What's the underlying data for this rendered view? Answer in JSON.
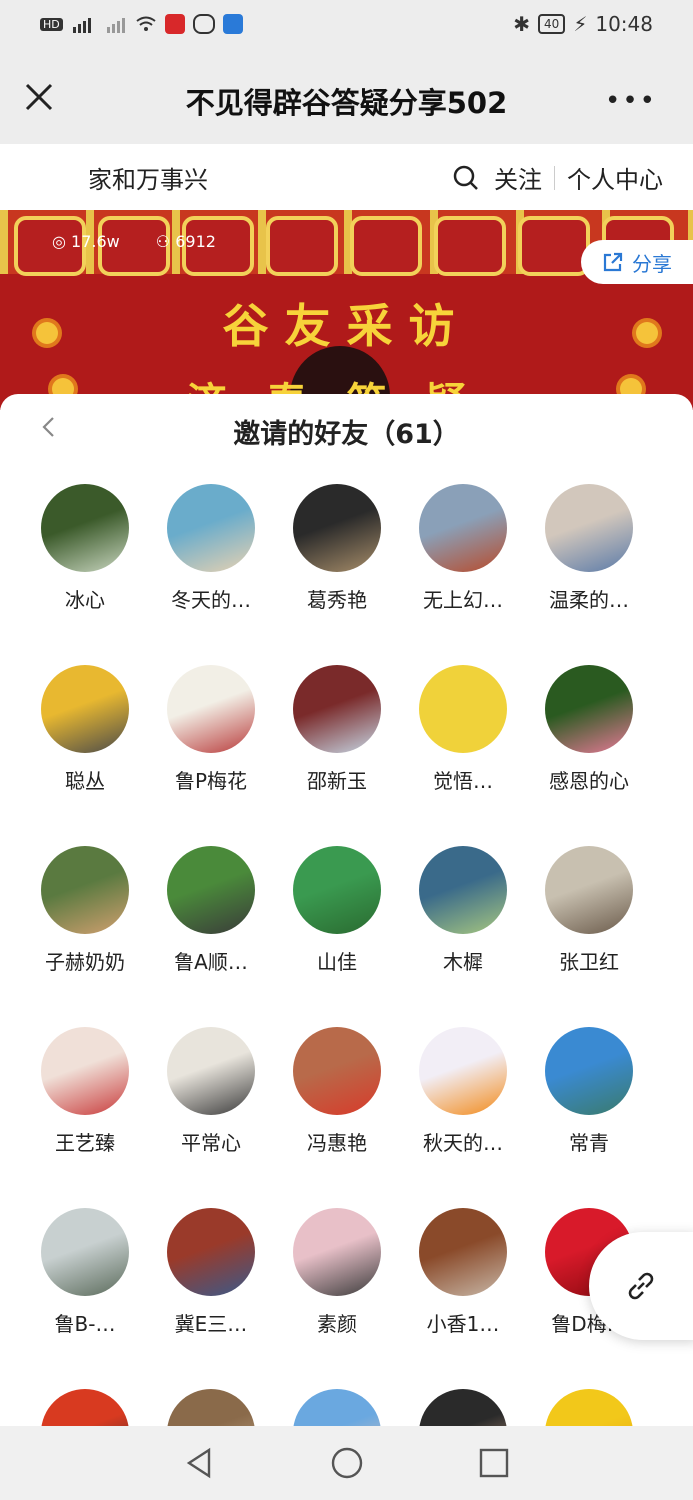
{
  "status_bar": {
    "left_indicators": [
      "HD",
      "4G",
      "signal-icon",
      "wifi-icon",
      "app-icon",
      "chat-icon",
      "notify-icon"
    ],
    "battery": "40",
    "time": "10:48"
  },
  "titlebar": {
    "title": "不见得辟谷答疑分享502",
    "more": "•••"
  },
  "subheader": {
    "channel_name": "家和万事兴",
    "follow": "关注",
    "personal_center": "个人中心"
  },
  "banner": {
    "views": "17.6w",
    "participants": "6912",
    "title_line1": "谷友采访",
    "title_line2": "济春答疑",
    "share_label": "分享"
  },
  "sheet": {
    "title": "邀请的好友（61）",
    "friends": [
      {
        "name": "冰心",
        "colors": [
          "#3b5a2a",
          "#c9d6c0"
        ]
      },
      {
        "name": "冬天的…",
        "colors": [
          "#6aaccb",
          "#e8d2b2"
        ]
      },
      {
        "name": "葛秀艳",
        "colors": [
          "#2a2a2a",
          "#a88e6a"
        ]
      },
      {
        "name": "无上幻…",
        "colors": [
          "#8aa0b8",
          "#b84a2a"
        ]
      },
      {
        "name": "温柔的…",
        "colors": [
          "#d2c7bc",
          "#5a7aa8"
        ]
      },
      {
        "name": "聪丛",
        "colors": [
          "#e8b830",
          "#4a4a4a"
        ]
      },
      {
        "name": "鲁P梅花",
        "colors": [
          "#f2efe6",
          "#b83a3a"
        ]
      },
      {
        "name": "邵新玉",
        "colors": [
          "#7a2a2a",
          "#c7d8e6"
        ]
      },
      {
        "name": "觉悟…",
        "colors": [
          "#f0d23a",
          "#f0d23a"
        ]
      },
      {
        "name": "感恩的心",
        "colors": [
          "#2a5a20",
          "#e87a98"
        ]
      },
      {
        "name": "子赫奶奶",
        "colors": [
          "#5a7a40",
          "#d2a070"
        ]
      },
      {
        "name": "鲁A顺…",
        "colors": [
          "#4a8a3a",
          "#3a3a3a"
        ]
      },
      {
        "name": "山佳",
        "colors": [
          "#3a9a50",
          "#2a6a30"
        ]
      },
      {
        "name": "木樨",
        "colors": [
          "#3a6a8a",
          "#a8c880"
        ]
      },
      {
        "name": "张卫红",
        "colors": [
          "#c8c0b0",
          "#6a5a4a"
        ]
      },
      {
        "name": "王艺臻",
        "colors": [
          "#f0e0d8",
          "#c83a3a"
        ]
      },
      {
        "name": "平常心",
        "colors": [
          "#e8e4dc",
          "#3a3a3a"
        ]
      },
      {
        "name": "冯惠艳",
        "colors": [
          "#b86a4a",
          "#d83a2a"
        ]
      },
      {
        "name": "秋天的…",
        "colors": [
          "#f2eef6",
          "#f28a1a"
        ]
      },
      {
        "name": "常青",
        "colors": [
          "#3a8ad2",
          "#3a7a6a"
        ]
      },
      {
        "name": "鲁B-…",
        "colors": [
          "#c8d0d0",
          "#5a6a5a"
        ]
      },
      {
        "name": "冀E三…",
        "colors": [
          "#9a3a2a",
          "#3a5a8a"
        ]
      },
      {
        "name": "素颜",
        "colors": [
          "#e8c0c8",
          "#3a3a3a"
        ]
      },
      {
        "name": "小香1…",
        "colors": [
          "#8a4a2a",
          "#c8b8a8"
        ]
      },
      {
        "name": "鲁D梅…",
        "colors": [
          "#d81a2a",
          "#8a0a10"
        ]
      },
      {
        "name": "",
        "colors": [
          "#d83a20",
          "#2a2a2a"
        ]
      },
      {
        "name": "",
        "colors": [
          "#8a6a4a",
          "#c8b090"
        ]
      },
      {
        "name": "",
        "colors": [
          "#6aa8e0",
          "#e8c8b8"
        ]
      },
      {
        "name": "",
        "colors": [
          "#2a2a2a",
          "#d8a88a"
        ]
      },
      {
        "name": "",
        "colors": [
          "#f2c81a",
          "#e8a010"
        ]
      }
    ]
  }
}
